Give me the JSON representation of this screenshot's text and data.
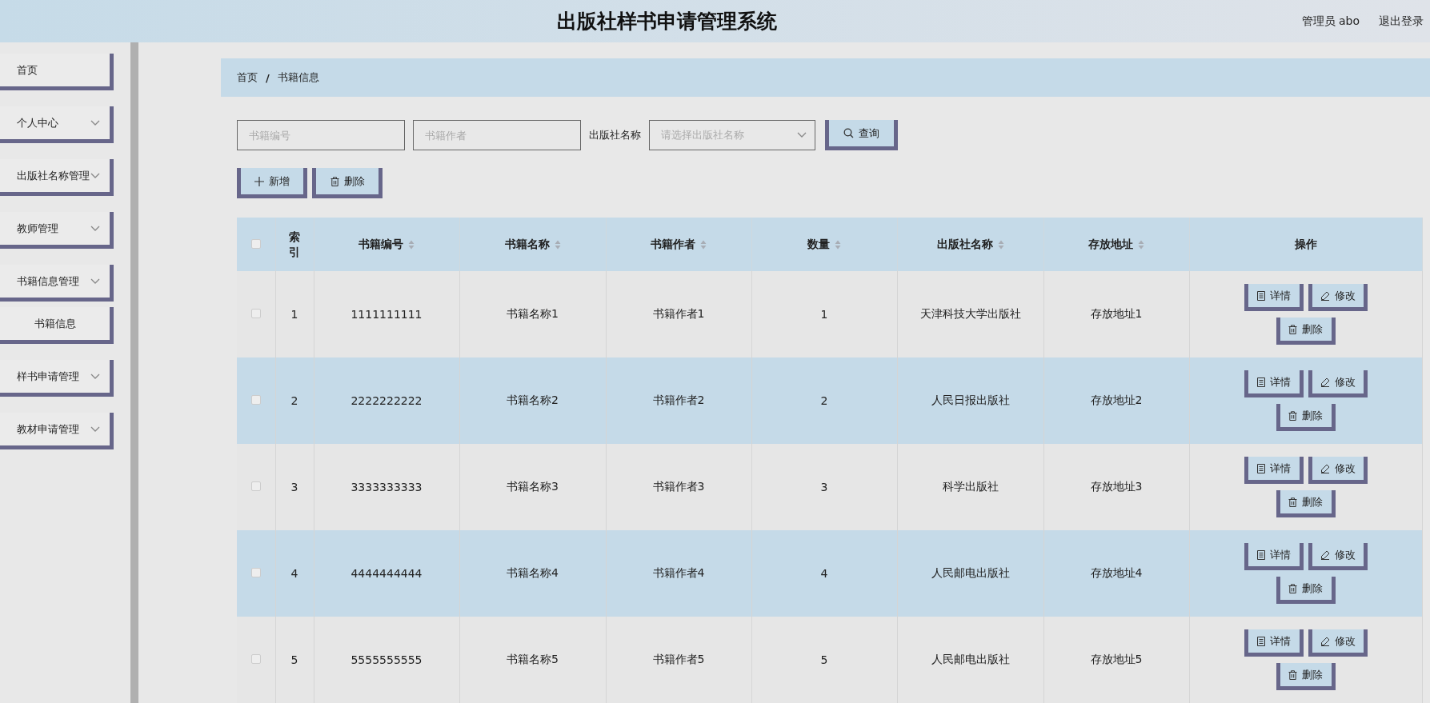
{
  "header": {
    "title": "出版社样书申请管理系统",
    "user": "管理员 abo",
    "logout": "退出登录"
  },
  "sidebar": {
    "items": [
      {
        "label": "首页",
        "kind": "link"
      },
      {
        "label": "个人中心",
        "kind": "group"
      },
      {
        "label": "出版社名称管理",
        "kind": "group"
      },
      {
        "label": "教师管理",
        "kind": "group"
      },
      {
        "label": "书籍信息管理",
        "kind": "group",
        "children": [
          {
            "label": "书籍信息"
          }
        ]
      },
      {
        "label": "样书申请管理",
        "kind": "group"
      },
      {
        "label": "教材申请管理",
        "kind": "group"
      }
    ]
  },
  "breadcrumb": {
    "items": [
      "首页",
      "书籍信息"
    ],
    "separator": "/"
  },
  "search": {
    "fields": [
      {
        "placeholder": "书籍编号"
      },
      {
        "placeholder": "书籍作者"
      }
    ],
    "publisher_label": "出版社名称",
    "publisher_select": {
      "placeholder": "请选择出版社名称"
    },
    "query_button": "查询"
  },
  "toolbar": {
    "buttons": [
      {
        "label": "新增",
        "kind": "add"
      },
      {
        "label": "删除",
        "kind": "delete"
      }
    ]
  },
  "table": {
    "header_checked": false,
    "columns": [
      {
        "label": "索引",
        "sortable": false
      },
      {
        "label": "书籍编号",
        "sortable": true
      },
      {
        "label": "书籍名称",
        "sortable": true
      },
      {
        "label": "书籍作者",
        "sortable": true
      },
      {
        "label": "数量",
        "sortable": true
      },
      {
        "label": "出版社名称",
        "sortable": true
      },
      {
        "label": "存放地址",
        "sortable": true
      },
      {
        "label": "操作",
        "sortable": false
      }
    ],
    "rows": [
      {
        "checked": false,
        "cells": [
          "1",
          "1111111111",
          "书籍名称1",
          "书籍作者1",
          "1",
          "天津科技大学出版社",
          "存放地址1"
        ],
        "actions": [
          {
            "label": "详情",
            "kind": "detail"
          },
          {
            "label": "修改",
            "kind": "edit"
          },
          {
            "label": "删除",
            "kind": "delete"
          }
        ]
      },
      {
        "checked": false,
        "cells": [
          "2",
          "2222222222",
          "书籍名称2",
          "书籍作者2",
          "2",
          "人民日报出版社",
          "存放地址2"
        ],
        "actions": [
          {
            "label": "详情",
            "kind": "detail"
          },
          {
            "label": "修改",
            "kind": "edit"
          },
          {
            "label": "删除",
            "kind": "delete"
          }
        ]
      },
      {
        "checked": false,
        "cells": [
          "3",
          "3333333333",
          "书籍名称3",
          "书籍作者3",
          "3",
          "科学出版社",
          "存放地址3"
        ],
        "actions": [
          {
            "label": "详情",
            "kind": "detail"
          },
          {
            "label": "修改",
            "kind": "edit"
          },
          {
            "label": "删除",
            "kind": "delete"
          }
        ]
      },
      {
        "checked": false,
        "cells": [
          "4",
          "4444444444",
          "书籍名称4",
          "书籍作者4",
          "4",
          "人民邮电出版社",
          "存放地址4"
        ],
        "actions": [
          {
            "label": "详情",
            "kind": "detail"
          },
          {
            "label": "修改",
            "kind": "edit"
          },
          {
            "label": "删除",
            "kind": "delete"
          }
        ]
      },
      {
        "checked": false,
        "cells": [
          "5",
          "5555555555",
          "书籍名称5",
          "书籍作者5",
          "5",
          "人民邮电出版社",
          "存放地址5"
        ],
        "actions": [
          {
            "label": "详情",
            "kind": "detail"
          },
          {
            "label": "修改",
            "kind": "edit"
          },
          {
            "label": "删除",
            "kind": "delete"
          }
        ]
      }
    ]
  }
}
